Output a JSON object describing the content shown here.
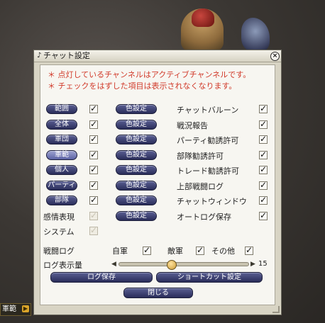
{
  "window": {
    "title": "チャット設定",
    "close_glyph": "×"
  },
  "notices": [
    "＊ 点灯しているチャンネルはアクティブチャンネルです。",
    "＊ チェックをはずした項目は表示されなくなります。"
  ],
  "channels": [
    {
      "label": "範囲",
      "type": "pill",
      "selected": false,
      "checked": true,
      "checkbox_enabled": true,
      "color_button": "色設定"
    },
    {
      "label": "全体",
      "type": "pill",
      "selected": false,
      "checked": true,
      "checkbox_enabled": true,
      "color_button": "色設定"
    },
    {
      "label": "軍団",
      "type": "pill",
      "selected": false,
      "checked": true,
      "checkbox_enabled": true,
      "color_button": "色設定"
    },
    {
      "label": "軍範",
      "type": "pill",
      "selected": true,
      "checked": true,
      "checkbox_enabled": true,
      "color_button": "色設定"
    },
    {
      "label": "個人",
      "type": "pill",
      "selected": false,
      "checked": true,
      "checkbox_enabled": true,
      "color_button": "色設定"
    },
    {
      "label": "パーティ",
      "type": "pill",
      "selected": false,
      "checked": true,
      "checkbox_enabled": true,
      "color_button": "色設定"
    },
    {
      "label": "部隊",
      "type": "pill",
      "selected": false,
      "checked": true,
      "checkbox_enabled": true,
      "color_button": "色設定"
    },
    {
      "label": "感情表現",
      "type": "text",
      "selected": false,
      "checked": true,
      "checkbox_enabled": false,
      "color_button": "色設定"
    },
    {
      "label": "システム",
      "type": "text",
      "selected": false,
      "checked": true,
      "checkbox_enabled": false,
      "color_button": ""
    }
  ],
  "options": [
    {
      "label": "チャットバルーン",
      "checked": true
    },
    {
      "label": "戦況報告",
      "checked": true
    },
    {
      "label": "パーティ勧誘許可",
      "checked": true
    },
    {
      "label": "部隊勧誘許可",
      "checked": true
    },
    {
      "label": "トレード勧誘許可",
      "checked": true
    },
    {
      "label": "上部戦闘ログ",
      "checked": true
    },
    {
      "label": "チャットウィンドウ",
      "checked": true
    },
    {
      "label": "オートログ保存",
      "checked": true
    }
  ],
  "battle_log": {
    "label": "戦闘ログ",
    "items": [
      {
        "label": "自軍",
        "checked": true
      },
      {
        "label": "敵軍",
        "checked": true
      },
      {
        "label": "その他",
        "checked": true
      }
    ]
  },
  "log_display": {
    "label": "ログ表示量",
    "value": "15",
    "level_fraction": 0.4,
    "left_arrow": "◀",
    "right_arrow": "▶"
  },
  "buttons": {
    "log_save": "ログ保存",
    "shortcut_settings": "ショートカット設定",
    "close": "閉じる"
  },
  "taskbar": {
    "tab_label": "軍範",
    "tab_arrow": "▶"
  },
  "check_glyph": "✓",
  "colors": {
    "notice_red": "#d13a2a",
    "pill_blue": "#2a2d5a",
    "window_bg": "#d8d4c4"
  }
}
